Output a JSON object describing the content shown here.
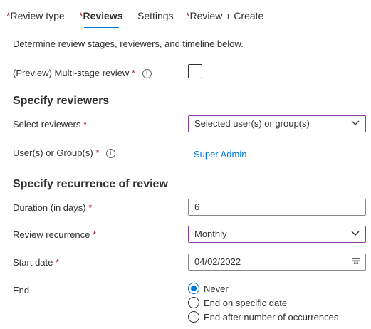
{
  "tabs": [
    {
      "label": "Review type",
      "required": true
    },
    {
      "label": "Reviews",
      "required": true,
      "active": true
    },
    {
      "label": "Settings",
      "required": false
    },
    {
      "label": "Review + Create",
      "required": true
    }
  ],
  "required_marker": "*",
  "description": "Determine review stages, reviewers, and timeline below.",
  "multistage": {
    "label": "(Preview) Multi-stage review",
    "checked": false,
    "info_icon": "info-icon"
  },
  "specify_reviewers": {
    "heading": "Specify reviewers",
    "select_reviewers": {
      "label": "Select reviewers",
      "value": "Selected user(s) or group(s)"
    },
    "users_groups": {
      "label": "User(s) or Group(s)",
      "link": "Super Admin"
    }
  },
  "recurrence": {
    "heading": "Specify recurrence of review",
    "duration": {
      "label": "Duration (in days)",
      "value": "6"
    },
    "review_recurrence": {
      "label": "Review recurrence",
      "value": "Monthly"
    },
    "start_date": {
      "label": "Start date",
      "value": "04/02/2022"
    },
    "end": {
      "label": "End",
      "options": [
        "Never",
        "End on specific date",
        "End after number of occurrences"
      ],
      "selected": "Never"
    }
  },
  "colors": {
    "accent": "#0078d4",
    "required": "#a4262c",
    "select_border": "#8a3b9e"
  }
}
